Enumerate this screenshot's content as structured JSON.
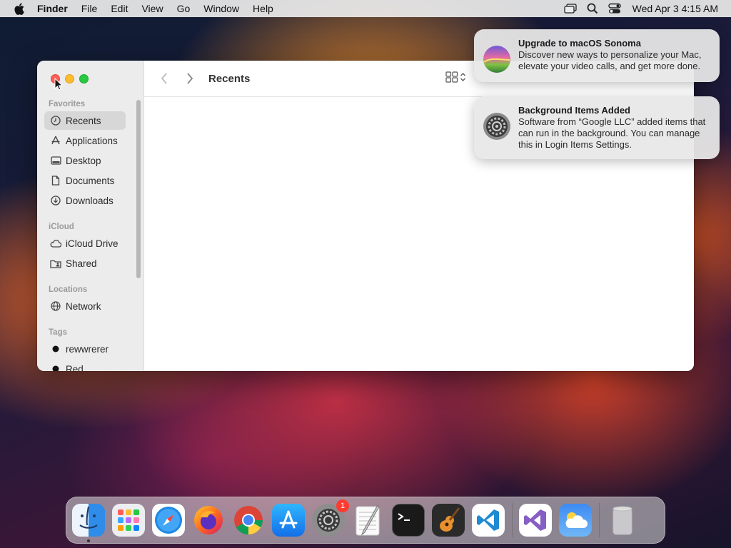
{
  "menubar": {
    "app_name": "Finder",
    "menus": [
      "File",
      "Edit",
      "View",
      "Go",
      "Window",
      "Help"
    ],
    "clock": "Wed Apr 3  4:15 AM",
    "status_icons": [
      "screen-mirroring-icon",
      "search-icon",
      "control-center-icon"
    ]
  },
  "finder": {
    "title": "Recents",
    "sidebar": {
      "favorites_label": "Favorites",
      "favorites": [
        {
          "label": "Recents",
          "icon": "clock-icon",
          "selected": true
        },
        {
          "label": "Applications",
          "icon": "applications-icon"
        },
        {
          "label": "Desktop",
          "icon": "desktop-icon"
        },
        {
          "label": "Documents",
          "icon": "document-icon"
        },
        {
          "label": "Downloads",
          "icon": "download-icon"
        }
      ],
      "icloud_label": "iCloud",
      "icloud": [
        {
          "label": "iCloud Drive",
          "icon": "cloud-icon"
        },
        {
          "label": "Shared",
          "icon": "shared-folder-icon"
        }
      ],
      "locations_label": "Locations",
      "locations": [
        {
          "label": "Network",
          "icon": "globe-icon"
        }
      ],
      "tags_label": "Tags",
      "tags": [
        {
          "label": "rewwrerer",
          "color": "#111111"
        },
        {
          "label": "Red",
          "color": "#111111"
        }
      ]
    }
  },
  "notifications": [
    {
      "title": "Upgrade to macOS Sonoma",
      "body": "Discover new ways to personalize your Mac, elevate your video calls, and get more done.",
      "icon": "macos-sonoma-icon"
    },
    {
      "title": "Background Items Added",
      "body": "Software from “Google LLC” added items that can run in the background. You can manage this in Login Items Settings.",
      "icon": "system-settings-icon"
    }
  ],
  "dock": {
    "apps": [
      "Finder",
      "Launchpad",
      "Safari",
      "Firefox",
      "Google Chrome",
      "App Store",
      "System Settings",
      "TextEdit",
      "Terminal",
      "GarageBand",
      "Visual Studio Code",
      "Visual Studio",
      "Weather",
      "Trash"
    ],
    "system_settings_badge": "1"
  }
}
